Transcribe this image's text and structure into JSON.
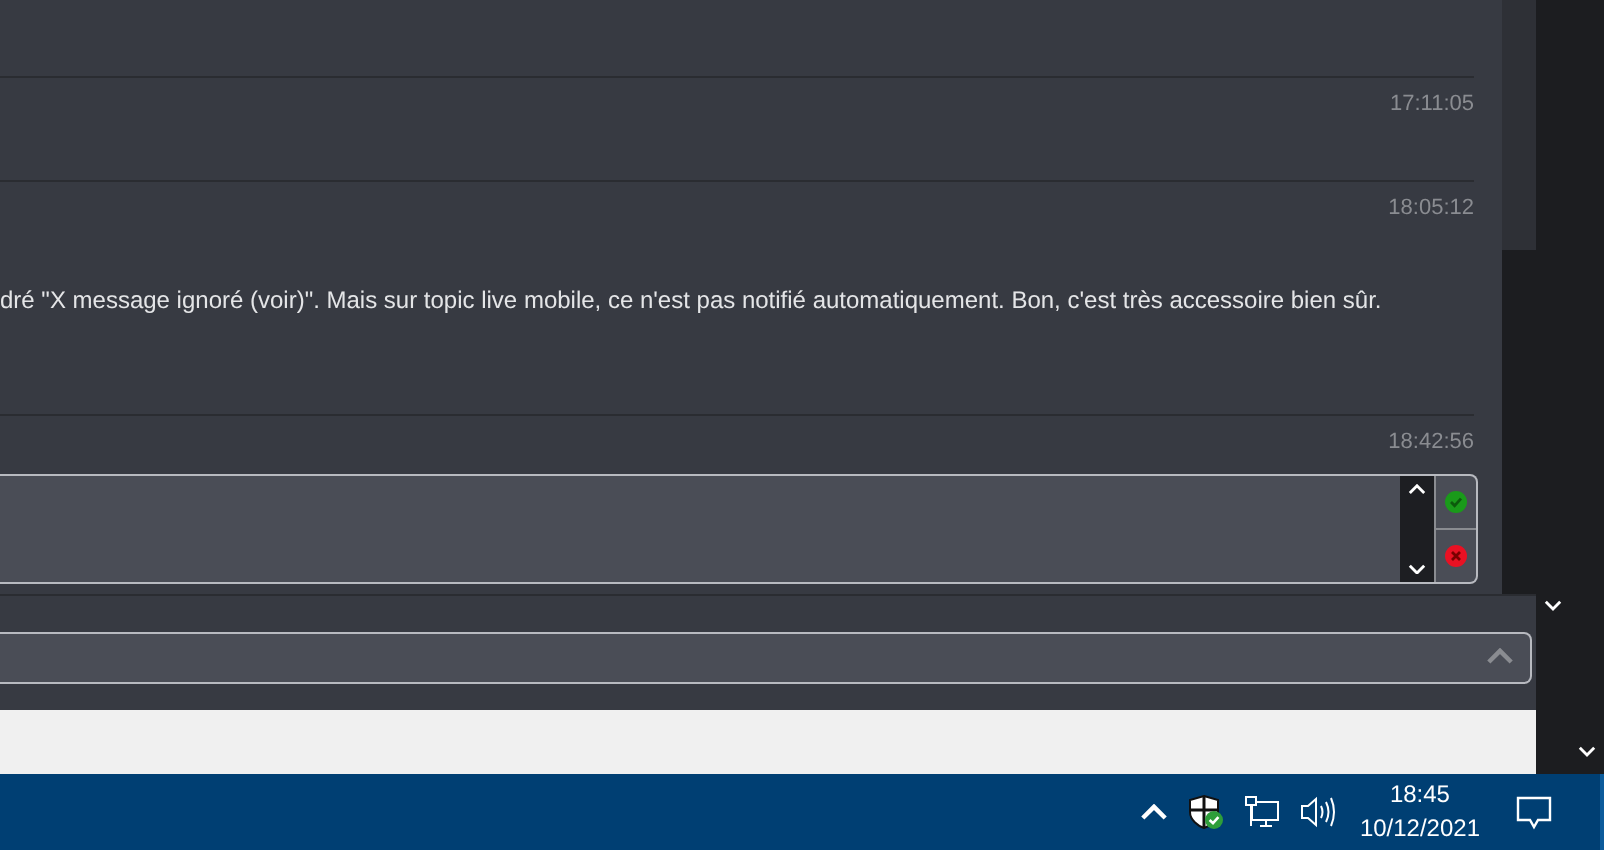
{
  "messages": [
    {
      "time": "17:11:05"
    },
    {
      "time": "18:05:12",
      "text": "dré \"X message ignoré (voir)\". Mais sur topic live mobile, ce n'est pas notifié automatiquement. Bon, c'est très accessoire bien sûr."
    },
    {
      "time": "18:42:56"
    }
  ],
  "taskbar": {
    "time": "18:45",
    "date": "10/12/2021"
  }
}
